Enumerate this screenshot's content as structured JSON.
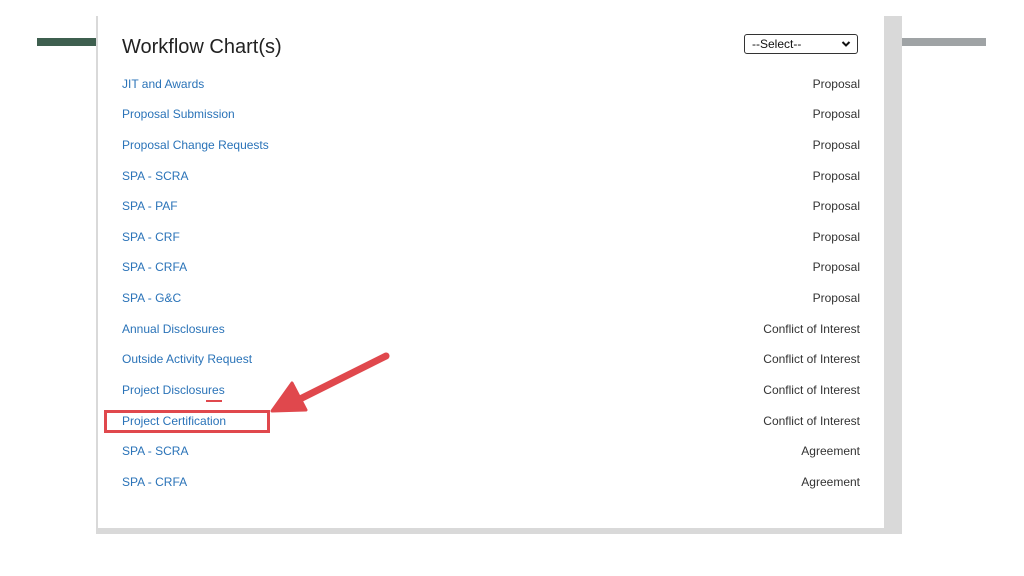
{
  "panel": {
    "title": "Workflow Chart(s)",
    "select": {
      "selected": "--Select--"
    }
  },
  "rows": [
    {
      "name": "JIT and Awards",
      "category": "Proposal"
    },
    {
      "name": "Proposal Submission",
      "category": "Proposal"
    },
    {
      "name": "Proposal Change Requests",
      "category": "Proposal"
    },
    {
      "name": "SPA - SCRA",
      "category": "Proposal"
    },
    {
      "name": "SPA - PAF",
      "category": "Proposal"
    },
    {
      "name": "SPA - CRF",
      "category": "Proposal"
    },
    {
      "name": "SPA - CRFA",
      "category": "Proposal"
    },
    {
      "name": "SPA - G&C",
      "category": "Proposal"
    },
    {
      "name": "Annual Disclosures",
      "category": "Conflict of Interest"
    },
    {
      "name": "Outside Activity Request",
      "category": "Conflict of Interest"
    },
    {
      "name": "Project Disclosures",
      "category": "Conflict of Interest"
    },
    {
      "name": "Project Certification",
      "category": "Conflict of Interest"
    },
    {
      "name": "SPA - SCRA",
      "category": "Agreement"
    },
    {
      "name": "SPA - CRFA",
      "category": "Agreement"
    }
  ],
  "colors": {
    "link": "#2a73b8",
    "annotation": "#e0484d",
    "accent_left_bar": "#3e5f4f",
    "accent_right_bar": "#9fa3a5"
  },
  "icons": {
    "select_caret": "chevron-down-icon",
    "annotation": "red-arrow"
  }
}
